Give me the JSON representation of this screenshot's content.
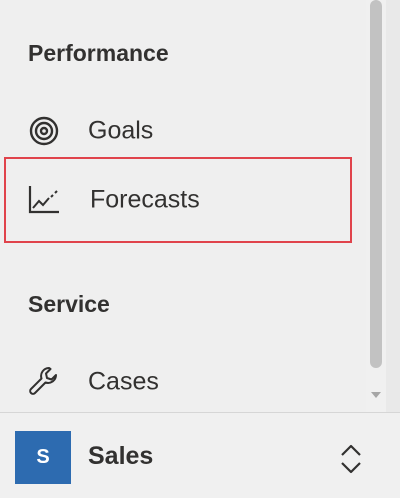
{
  "sitemap": {
    "groups": [
      {
        "title": "Performance",
        "items": [
          {
            "label": "Goals",
            "icon": "goals-target-icon"
          },
          {
            "label": "Forecasts",
            "icon": "forecast-chart-icon",
            "highlighted": true
          }
        ]
      },
      {
        "title": "Service",
        "items": [
          {
            "label": "Cases",
            "icon": "wrench-icon"
          }
        ]
      }
    ]
  },
  "area_switcher": {
    "badge": "S",
    "name": "Sales",
    "icon": "up-down-chevron-icon",
    "badge_color": "#2d6bb0"
  },
  "colors": {
    "highlight_border": "#e0434b",
    "scroll_thumb": "#c2c2c2"
  }
}
